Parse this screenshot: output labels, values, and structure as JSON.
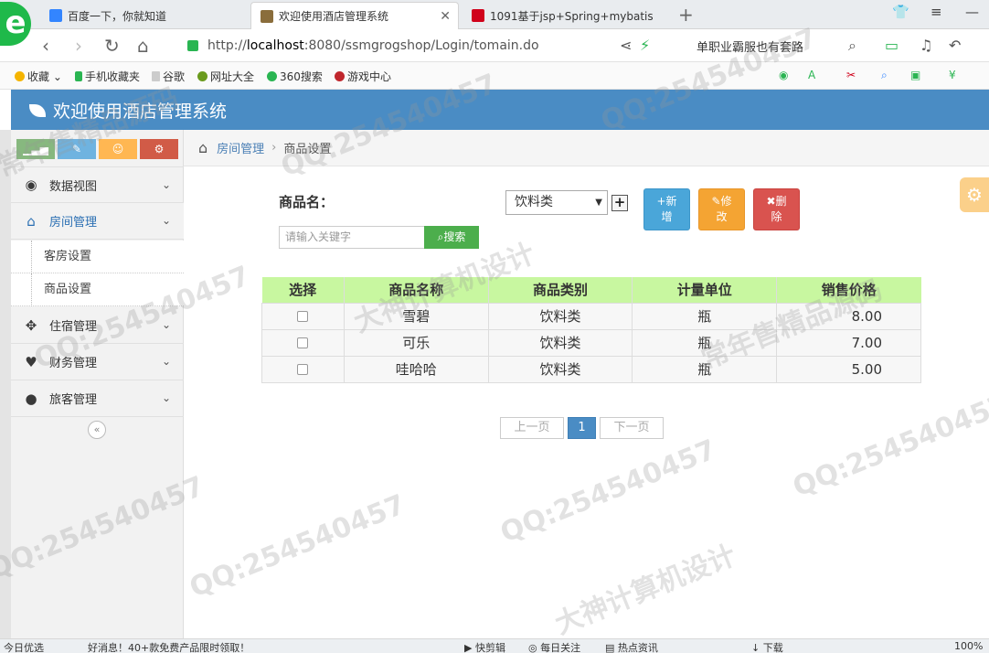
{
  "browser": {
    "logo": "e",
    "tabs": [
      {
        "label": "百度一下，你就知道",
        "color": "#3385ff"
      },
      {
        "label": "欢迎使用酒店管理系统",
        "color": "#8a6d3b"
      },
      {
        "label": "1091基于jsp+Spring+mybatis",
        "color": "#d0021b"
      }
    ],
    "new_tab": "+",
    "url_prefix": "http://",
    "url_host": "localhost",
    "url_rest": ":8080/ssmgrogshop/Login/tomain.do",
    "ad_text": "单职业霸服也有套路",
    "bookmarks": [
      "收藏",
      "手机收藏夹",
      "谷歌",
      "网址大全",
      "360搜索",
      "游戏中心"
    ]
  },
  "app": {
    "title": "欢迎使用酒店管理系统",
    "accent": "#4a8cc4"
  },
  "sidebar": {
    "shortcuts": [
      {
        "icon": "signal-icon",
        "glyph": "▁▃▅",
        "color": "#87b87f"
      },
      {
        "icon": "pencil-icon",
        "glyph": "✎",
        "color": "#6fb3e0"
      },
      {
        "icon": "users-icon",
        "glyph": "☺",
        "color": "#ffb752"
      },
      {
        "icon": "cogs-icon",
        "glyph": "⚙",
        "color": "#d15b47"
      }
    ],
    "menu": [
      {
        "label": "数据视图",
        "icon": "dashboard-icon",
        "glyph": "◉"
      },
      {
        "label": "房间管理",
        "icon": "home-icon",
        "glyph": "⌂"
      },
      {
        "label": "住宿管理",
        "icon": "move-icon",
        "glyph": "✥"
      },
      {
        "label": "财务管理",
        "icon": "heart-icon",
        "glyph": "♥"
      },
      {
        "label": "旅客管理",
        "icon": "user-icon",
        "glyph": "●"
      }
    ],
    "submenu": [
      "客房设置",
      "商品设置"
    ]
  },
  "breadcrumb": {
    "parent": "房间管理",
    "current": "商品设置"
  },
  "form": {
    "name_label": "商品名：",
    "category_selected": "饮料类",
    "search_placeholder": "请输入关键字",
    "search_button": "搜索",
    "add_button": [
      "+新",
      "增"
    ],
    "edit_button": [
      "✎修",
      "改"
    ],
    "delete_button": [
      "✖删",
      "除"
    ]
  },
  "table": {
    "columns": [
      "选择",
      "商品名称",
      "商品类别",
      "计量单位",
      "销售价格"
    ],
    "rows": [
      {
        "name": "雪碧",
        "category": "饮料类",
        "unit": "瓶",
        "price": "8.00"
      },
      {
        "name": "可乐",
        "category": "饮料类",
        "unit": "瓶",
        "price": "7.00"
      },
      {
        "name": "哇哈哈",
        "category": "饮料类",
        "unit": "瓶",
        "price": "5.00"
      }
    ]
  },
  "pager": {
    "prev": "上一页",
    "current": "1",
    "next": "下一页"
  },
  "statusbar": {
    "items": [
      "今日优选",
      "好消息！40+款免费产品限时领取！",
      "快剪辑",
      "每日关注",
      "热点资讯",
      "下载",
      "100%"
    ]
  },
  "watermarks": [
    "QQ:254540457",
    "常年售精品源码",
    "大神计算机设计"
  ]
}
